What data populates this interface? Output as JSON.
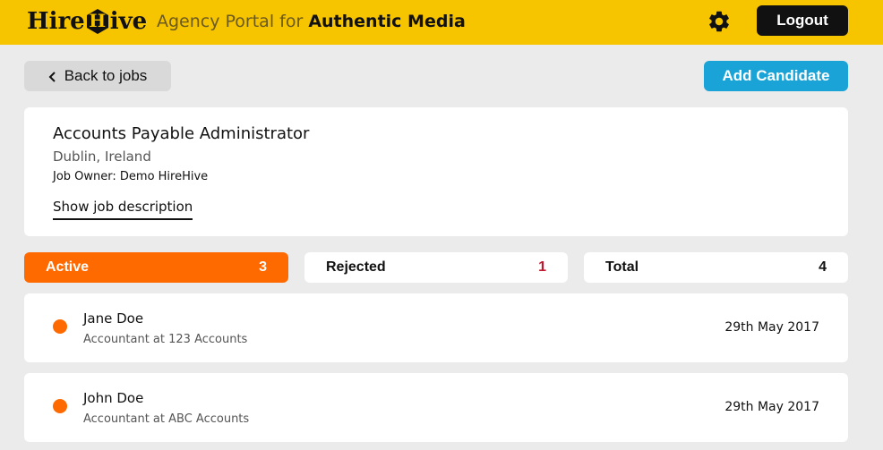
{
  "header": {
    "logo_left": "Hire",
    "logo_hex_letter": "H",
    "logo_right": "ive",
    "portal_prefix": "Agency Portal for",
    "agency_name": "Authentic Media",
    "settings_icon": "gear-icon",
    "logout_label": "Logout",
    "bar_color": "#f7c400"
  },
  "toolbar": {
    "back_label": "Back to jobs",
    "add_label": "Add Candidate",
    "add_color": "#1aa3d6"
  },
  "job": {
    "title": "Accounts Payable Administrator",
    "location": "Dublin, Ireland",
    "owner": "Job Owner: Demo HireHive",
    "description_link": "Show job description"
  },
  "tabs": [
    {
      "label": "Active",
      "count": "3",
      "color": "#ff6a00"
    },
    {
      "label": "Rejected",
      "count": "1",
      "count_color": "#c0182e"
    },
    {
      "label": "Total",
      "count": "4"
    }
  ],
  "candidates": [
    {
      "name": "Jane Doe",
      "role": "Accountant at 123 Accounts",
      "date": "29th May 2017",
      "status_color": "#ff6a00"
    },
    {
      "name": "John Doe",
      "role": "Accountant at ABC Accounts",
      "date": "29th May 2017",
      "status_color": "#ff6a00"
    }
  ]
}
